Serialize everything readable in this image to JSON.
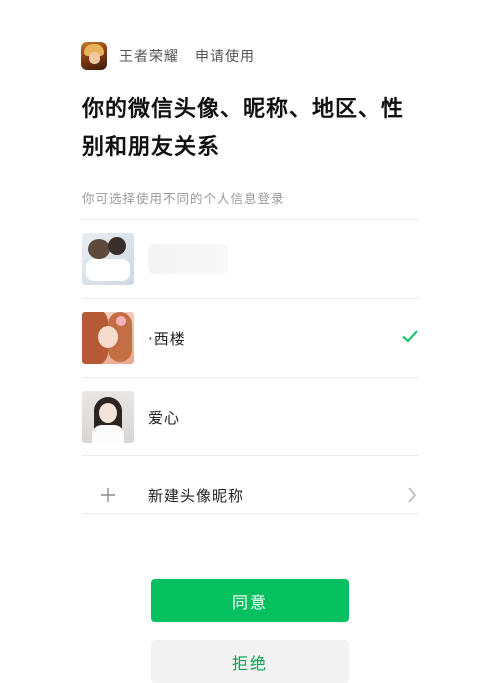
{
  "header": {
    "app_name": "王者荣耀",
    "action": "申请使用"
  },
  "title": "你的微信头像、昵称、地区、性别和朋友关系",
  "hint": "你可选择使用不同的个人信息登录",
  "accounts": [
    {
      "name": ""
    },
    {
      "name": "·西楼",
      "selected": true
    },
    {
      "name": "爱心"
    }
  ],
  "new_profile": {
    "label": "新建头像昵称"
  },
  "buttons": {
    "agree": "同意",
    "reject": "拒绝"
  },
  "colors": {
    "accent": "#07c160",
    "check": "#07c160"
  }
}
